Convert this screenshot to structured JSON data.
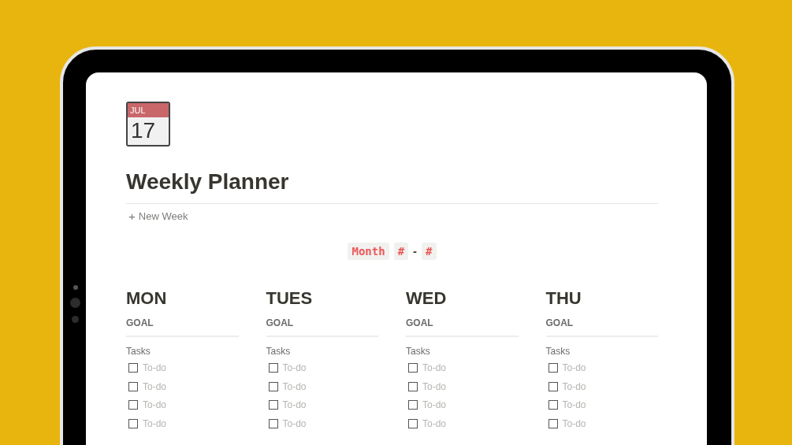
{
  "page_icon": {
    "month": "JUL",
    "day": "17"
  },
  "title": "Weekly Planner",
  "new_button": {
    "icon": "+",
    "label": "New Week"
  },
  "date_range": [
    {
      "text": "Month"
    },
    {
      "text": "#"
    },
    {
      "separator": "-"
    },
    {
      "text": "#"
    }
  ],
  "days": [
    {
      "name": "MON",
      "goal_label": "GOAL",
      "tasks_label": "Tasks",
      "todos": [
        {
          "placeholder": "To-do",
          "checked": false
        },
        {
          "placeholder": "To-do",
          "checked": false
        },
        {
          "placeholder": "To-do",
          "checked": false
        },
        {
          "placeholder": "To-do",
          "checked": false
        }
      ]
    },
    {
      "name": "TUES",
      "goal_label": "GOAL",
      "tasks_label": "Tasks",
      "todos": [
        {
          "placeholder": "To-do",
          "checked": false
        },
        {
          "placeholder": "To-do",
          "checked": false
        },
        {
          "placeholder": "To-do",
          "checked": false
        },
        {
          "placeholder": "To-do",
          "checked": false
        }
      ]
    },
    {
      "name": "WED",
      "goal_label": "GOAL",
      "tasks_label": "Tasks",
      "todos": [
        {
          "placeholder": "To-do",
          "checked": false
        },
        {
          "placeholder": "To-do",
          "checked": false
        },
        {
          "placeholder": "To-do",
          "checked": false
        },
        {
          "placeholder": "To-do",
          "checked": false
        }
      ]
    },
    {
      "name": "THU",
      "goal_label": "GOAL",
      "tasks_label": "Tasks",
      "todos": [
        {
          "placeholder": "To-do",
          "checked": false
        },
        {
          "placeholder": "To-do",
          "checked": false
        },
        {
          "placeholder": "To-do",
          "checked": false
        },
        {
          "placeholder": "To-do",
          "checked": false
        }
      ]
    }
  ]
}
